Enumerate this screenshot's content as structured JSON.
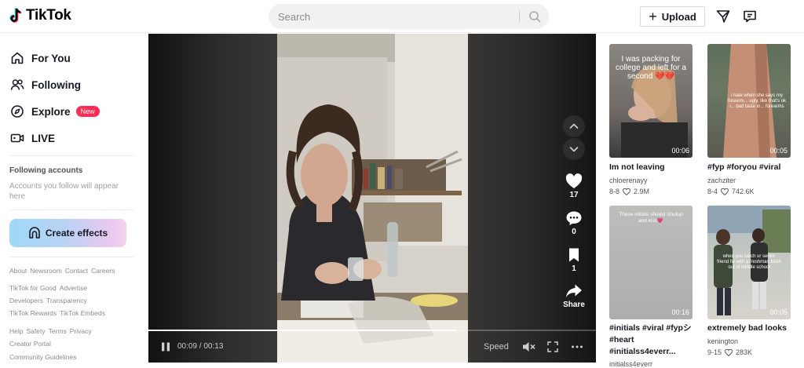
{
  "header": {
    "logo_text": "TikTok",
    "search_placeholder": "Search",
    "upload_label": "Upload",
    "brand_colors": {
      "accent": "#fe2c55",
      "cyan": "#25f4ee"
    }
  },
  "sidebar": {
    "nav": [
      {
        "label": "For You",
        "icon": "home-icon"
      },
      {
        "label": "Following",
        "icon": "users-icon"
      },
      {
        "label": "Explore",
        "icon": "compass-icon",
        "badge": "New"
      },
      {
        "label": "LIVE",
        "icon": "live-icon"
      }
    ],
    "following_title": "Following accounts",
    "following_desc": "Accounts you follow will appear here",
    "create_effects": "Create effects",
    "links": [
      [
        "About",
        "Newsroom",
        "Contact",
        "Careers"
      ],
      [
        "TikTok for Good",
        "Advertise"
      ],
      [
        "Developers",
        "Transparency"
      ],
      [
        "TikTok Rewards",
        "TikTok Embeds"
      ],
      [
        "Help",
        "Safety",
        "Terms",
        "Privacy"
      ],
      [
        "Creator Portal"
      ],
      [
        "Community Guidelines"
      ]
    ]
  },
  "player": {
    "likes": "17",
    "comments": "0",
    "saves": "1",
    "share_label": "Share",
    "time": "00:09 / 00:13",
    "speed_label": "Speed",
    "progress": 0.69
  },
  "recommended": [
    {
      "caption": "I was packing for college and left for a second 💔💔",
      "duration": "00:06",
      "title": "Im not leaving",
      "author": "chloerenayy",
      "date": "8-8",
      "likes": "2.9M"
    },
    {
      "caption": "i hate when she says my forearm... ugly, like that's ok i... bad taste in... forearms",
      "duration": "00:05",
      "title": "#fyp #foryou #viral",
      "author": "zachziter",
      "date": "8-4",
      "likes": "742.6K"
    },
    {
      "caption": "These initials should Shutup and kiss💗",
      "duration": "00:16",
      "title": "#initials #viral #fypシ #heart #initialss4everr...",
      "author": "initialss4everr",
      "date": "",
      "likes": ""
    },
    {
      "caption": "when you catch ur senior friend fw with a freshman fresh out of middle school",
      "duration": "00:05",
      "title": "extremely bad looks",
      "author": "kenington",
      "date": "9-15",
      "likes": "283K"
    }
  ]
}
